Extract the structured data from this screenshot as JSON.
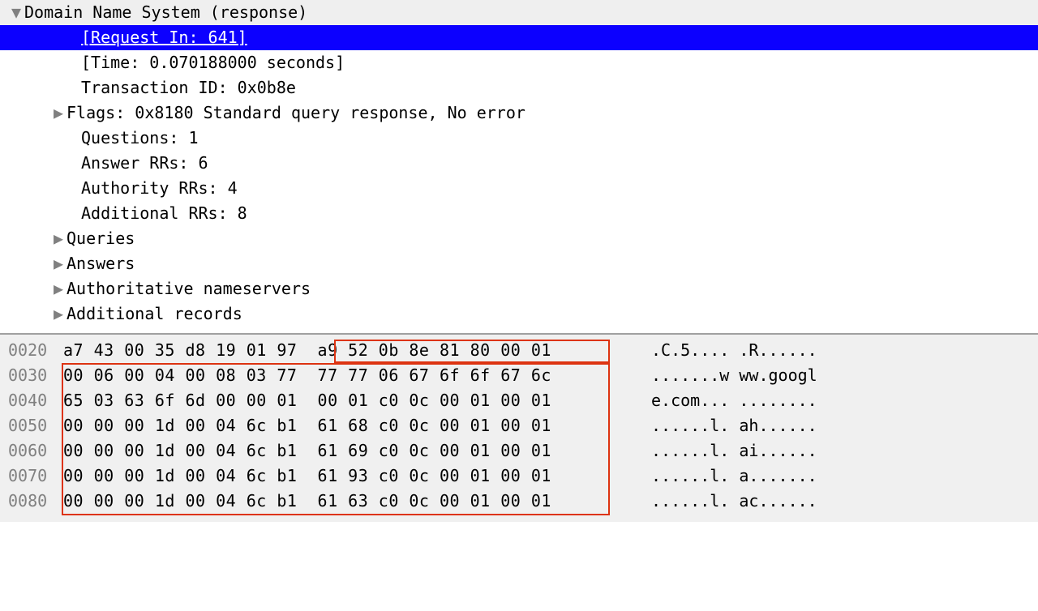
{
  "tree": {
    "header": "Domain Name System (response)",
    "request_in": "[Request In: 641]",
    "time": "[Time: 0.070188000 seconds]",
    "transaction_id": "Transaction ID: 0x0b8e",
    "flags": "Flags: 0x8180 Standard query response, No error",
    "questions": "Questions: 1",
    "answer_rrs": "Answer RRs: 6",
    "authority_rrs": "Authority RRs: 4",
    "additional_rrs": "Additional RRs: 8",
    "queries": "Queries",
    "answers": "Answers",
    "auth_ns": "Authoritative nameservers",
    "add_records": "Additional records"
  },
  "hex": {
    "rows": [
      {
        "offset": "0020",
        "bytes": "a7 43 00 35 d8 19 01 97  a9 52 0b 8e 81 80 00 01",
        "ascii": ".C.5.... .R......"
      },
      {
        "offset": "0030",
        "bytes": "00 06 00 04 00 08 03 77  77 77 06 67 6f 6f 67 6c",
        "ascii": ".......w ww.googl"
      },
      {
        "offset": "0040",
        "bytes": "65 03 63 6f 6d 00 00 01  00 01 c0 0c 00 01 00 01",
        "ascii": "e.com... ........"
      },
      {
        "offset": "0050",
        "bytes": "00 00 00 1d 00 04 6c b1  61 68 c0 0c 00 01 00 01",
        "ascii": "......l. ah......"
      },
      {
        "offset": "0060",
        "bytes": "00 00 00 1d 00 04 6c b1  61 69 c0 0c 00 01 00 01",
        "ascii": "......l. ai......"
      },
      {
        "offset": "0070",
        "bytes": "00 00 00 1d 00 04 6c b1  61 93 c0 0c 00 01 00 01",
        "ascii": "......l. a......."
      },
      {
        "offset": "0080",
        "bytes": "00 00 00 1d 00 04 6c b1  61 63 c0 0c 00 01 00 01",
        "ascii": "......l. ac......"
      }
    ]
  }
}
